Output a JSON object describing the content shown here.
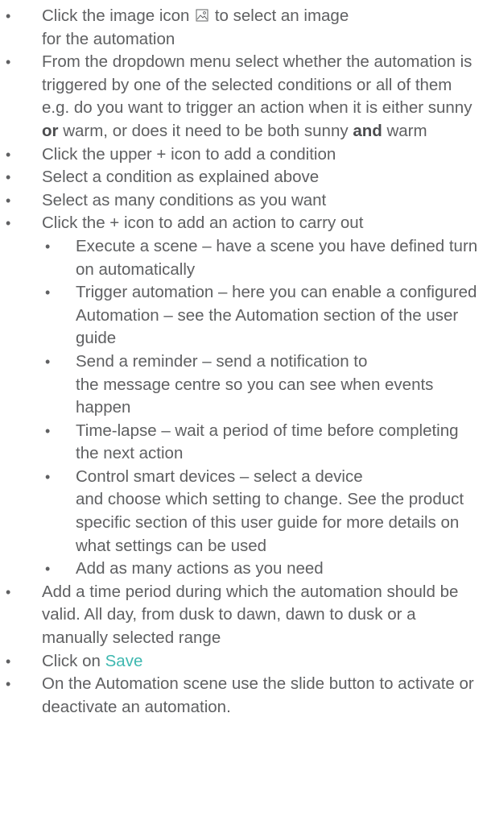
{
  "steps": {
    "s1_a": "Click the image icon",
    "s1_b": "to select an image",
    "s1_c": "for the automation",
    "s2_a": "From the dropdown menu select whether the automation is triggered by one of the selected conditions or all of them e.g. do you want to trigger an action when it is either sunny",
    "s2_or": "or",
    "s2_b": "warm, or does it need to be both sunny",
    "s2_and": "and",
    "s2_c": "warm",
    "s3": "Click the upper + icon to add a condition",
    "s4": "Select a condition as explained above",
    "s5": "Select as many conditions as you want",
    "s6": "Click the + icon to add an action to carry out",
    "sub": {
      "a1": "Execute a scene – have a scene you have defined turn on automatically",
      "a2": "Trigger automation – here you can enable a configured Automation – see the Automation section of the user guide",
      "a3_a": "Send a reminder – send a notification to",
      "a3_b": "the message centre so you can see when events happen",
      "a4": "Time-lapse – wait a period of time before completing the next action",
      "a5_a": "Control smart devices – select a device",
      "a5_b": "and choose which setting to change. See the product specific section of this user guide for more details on what settings can be used",
      "a6": "Add as many actions as you need"
    },
    "s7": "Add a time period during which the automation should be valid. All day, from dusk to dawn, dawn to dusk or a manually selected range",
    "s8_a": "Click on",
    "s8_save": "Save",
    "s9": "On the Automation scene use the slide button to activate or deactivate an automation."
  },
  "icons": {
    "image_icon": "image-icon"
  },
  "colors": {
    "text": "#5f6062",
    "accent": "#3fb8b0"
  }
}
